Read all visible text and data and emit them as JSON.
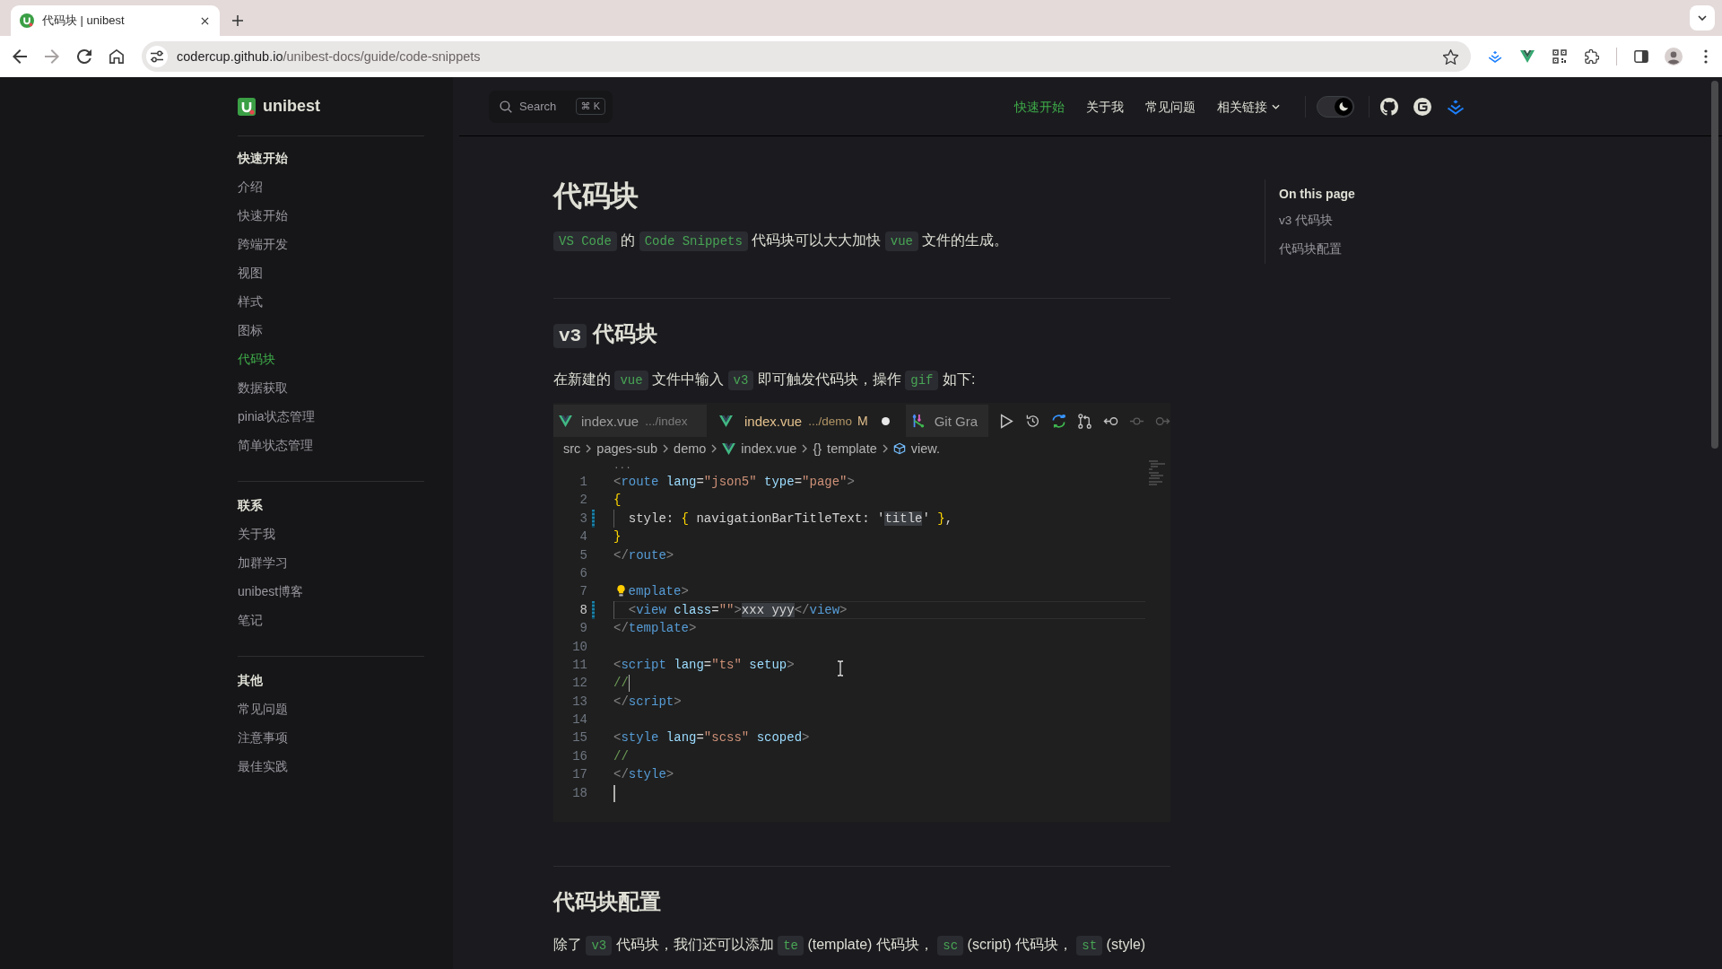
{
  "browser": {
    "tab": {
      "title": "代码块 | unibest",
      "selected": true
    },
    "url": {
      "host": "codercup.github.io",
      "path": "/unibest-docs/guide/code-snippets"
    }
  },
  "header": {
    "site_name": "unibest",
    "search": {
      "label": "Search",
      "shortcut": "⌘ K"
    },
    "nav": [
      {
        "label": "快速开始",
        "kind": "link",
        "selected": true
      },
      {
        "label": "关于我",
        "kind": "link",
        "selected": false
      },
      {
        "label": "常见问题",
        "kind": "link",
        "selected": false
      },
      {
        "label": "相关链接",
        "kind": "dropdown",
        "selected": false
      }
    ],
    "dark_mode": true
  },
  "sidebar": {
    "groups": [
      {
        "title": "快速开始",
        "items": [
          {
            "label": "介绍",
            "selected": false
          },
          {
            "label": "快速开始",
            "selected": false
          },
          {
            "label": "跨端开发",
            "selected": false
          },
          {
            "label": "视图",
            "selected": false
          },
          {
            "label": "样式",
            "selected": false
          },
          {
            "label": "图标",
            "selected": false
          },
          {
            "label": "代码块",
            "selected": true
          },
          {
            "label": "数据获取",
            "selected": false
          },
          {
            "label": "pinia状态管理",
            "selected": false
          },
          {
            "label": "简单状态管理",
            "selected": false
          }
        ]
      },
      {
        "title": "联系",
        "items": [
          {
            "label": "关于我",
            "selected": false
          },
          {
            "label": "加群学习",
            "selected": false
          },
          {
            "label": "unibest博客",
            "selected": false
          },
          {
            "label": "笔记",
            "selected": false
          }
        ]
      },
      {
        "title": "其他",
        "items": [
          {
            "label": "常见问题",
            "selected": false
          },
          {
            "label": "注意事项",
            "selected": false
          },
          {
            "label": "最佳实践",
            "selected": false
          }
        ]
      }
    ]
  },
  "article": {
    "title": "代码块",
    "intro": [
      {
        "kind": "code",
        "text": "VS Code"
      },
      {
        "kind": "text",
        "text": " 的 "
      },
      {
        "kind": "code",
        "text": "Code Snippets"
      },
      {
        "kind": "text",
        "text": " 代码块可以大大加快 "
      },
      {
        "kind": "code",
        "text": "vue"
      },
      {
        "kind": "text",
        "text": " 文件的生成。"
      }
    ],
    "sections": [
      {
        "heading": [
          {
            "kind": "code",
            "text": "v3"
          },
          {
            "kind": "text",
            "text": " 代码块"
          }
        ],
        "paragraph": [
          {
            "kind": "text",
            "text": "在新建的 "
          },
          {
            "kind": "code",
            "text": "vue"
          },
          {
            "kind": "text",
            "text": " 文件中输入 "
          },
          {
            "kind": "code",
            "text": "v3"
          },
          {
            "kind": "text",
            "text": " 即可触发代码块，操作 "
          },
          {
            "kind": "code",
            "text": "gif"
          },
          {
            "kind": "text",
            "text": " 如下:"
          }
        ],
        "editor": {
          "tabs": [
            {
              "kind": "file",
              "name": "index.vue",
              "path": ".../index",
              "modified": false,
              "selected": false
            },
            {
              "kind": "file",
              "name": "index.vue",
              "path": ".../demo",
              "badge": "M",
              "modified": true,
              "selected": true
            },
            {
              "kind": "git-graph",
              "name": "Git Gra",
              "selected": false
            }
          ],
          "breadcrumbs": [
            {
              "kind": "folder",
              "label": "src"
            },
            {
              "kind": "folder",
              "label": "pages-sub"
            },
            {
              "kind": "folder",
              "label": "demo"
            },
            {
              "kind": "vue-file",
              "label": "index.vue"
            },
            {
              "kind": "braces",
              "glyph": "{}",
              "label": "template"
            },
            {
              "kind": "element",
              "label": "view."
            }
          ],
          "fold_marker": "...",
          "lines": [
            {
              "number": "1",
              "current": false,
              "changed": false,
              "tokens": [
                {
                  "kind": "punct",
                  "text": "<"
                },
                {
                  "kind": "tag",
                  "text": "route"
                },
                {
                  "kind": "attr",
                  "text": " lang"
                },
                {
                  "kind": "text",
                  "text": "="
                },
                {
                  "kind": "string",
                  "text": "\"json5\""
                },
                {
                  "kind": "attr",
                  "text": " type"
                },
                {
                  "kind": "text",
                  "text": "="
                },
                {
                  "kind": "string",
                  "text": "\"page\""
                },
                {
                  "kind": "punct",
                  "text": ">"
                }
              ]
            },
            {
              "number": "2",
              "current": false,
              "changed": false,
              "tokens": [
                {
                  "kind": "bracket",
                  "text": "{"
                }
              ]
            },
            {
              "number": "3",
              "current": false,
              "changed": true,
              "tokens": [
                {
                  "kind": "indent"
                },
                {
                  "kind": "text",
                  "text": "style: "
                },
                {
                  "kind": "bracket",
                  "text": "{"
                },
                {
                  "kind": "text",
                  "text": " navigationBarTitleText: '"
                },
                {
                  "kind": "match",
                  "text": "title"
                },
                {
                  "kind": "text",
                  "text": "' "
                },
                {
                  "kind": "bracket",
                  "text": "}"
                },
                {
                  "kind": "text",
                  "text": ","
                }
              ]
            },
            {
              "number": "4",
              "current": false,
              "changed": false,
              "tokens": [
                {
                  "kind": "bracket",
                  "text": "}"
                }
              ]
            },
            {
              "number": "5",
              "current": false,
              "changed": false,
              "tokens": [
                {
                  "kind": "punct",
                  "text": "</"
                },
                {
                  "kind": "tag",
                  "text": "route"
                },
                {
                  "kind": "punct",
                  "text": ">"
                }
              ]
            },
            {
              "number": "6",
              "current": false,
              "changed": false
            },
            {
              "number": "7",
              "current": false,
              "changed": false,
              "tokens": [
                {
                  "kind": "lightbulb"
                },
                {
                  "kind": "tag",
                  "text": "emplate"
                },
                {
                  "kind": "punct",
                  "text": ">"
                }
              ]
            },
            {
              "number": "8",
              "current": true,
              "changed": true,
              "tokens": [
                {
                  "kind": "indent"
                },
                {
                  "kind": "punct",
                  "text": "<"
                },
                {
                  "kind": "tag",
                  "text": "view"
                },
                {
                  "kind": "attr",
                  "text": " class"
                },
                {
                  "kind": "text",
                  "text": "="
                },
                {
                  "kind": "string",
                  "text": "\"\""
                },
                {
                  "kind": "punct",
                  "text": ">"
                },
                {
                  "kind": "match",
                  "text": "xxx yyy"
                },
                {
                  "kind": "punct",
                  "text": "</"
                },
                {
                  "kind": "tag",
                  "text": "view"
                },
                {
                  "kind": "punct",
                  "text": ">"
                }
              ]
            },
            {
              "number": "9",
              "current": false,
              "changed": false,
              "tokens": [
                {
                  "kind": "punct",
                  "text": "</"
                },
                {
                  "kind": "tag",
                  "text": "template"
                },
                {
                  "kind": "punct",
                  "text": ">"
                }
              ]
            },
            {
              "number": "10",
              "current": false,
              "changed": false
            },
            {
              "number": "11",
              "current": false,
              "changed": false,
              "tokens": [
                {
                  "kind": "punct",
                  "text": "<"
                },
                {
                  "kind": "tag",
                  "text": "script"
                },
                {
                  "kind": "attr",
                  "text": " lang"
                },
                {
                  "kind": "text",
                  "text": "="
                },
                {
                  "kind": "string",
                  "text": "\"ts\""
                },
                {
                  "kind": "attr",
                  "text": " setup"
                },
                {
                  "kind": "punct",
                  "text": ">"
                }
              ]
            },
            {
              "number": "12",
              "current": false,
              "changed": false,
              "tokens": [
                {
                  "kind": "comment",
                  "text": "//"
                },
                {
                  "kind": "cursor"
                }
              ]
            },
            {
              "number": "13",
              "current": false,
              "changed": false,
              "tokens": [
                {
                  "kind": "punct",
                  "text": "</"
                },
                {
                  "kind": "tag",
                  "text": "script"
                },
                {
                  "kind": "punct",
                  "text": ">"
                }
              ]
            },
            {
              "number": "14",
              "current": false,
              "changed": false
            },
            {
              "number": "15",
              "current": false,
              "changed": false,
              "tokens": [
                {
                  "kind": "punct",
                  "text": "<"
                },
                {
                  "kind": "tag",
                  "text": "style"
                },
                {
                  "kind": "attr",
                  "text": " lang"
                },
                {
                  "kind": "text",
                  "text": "="
                },
                {
                  "kind": "string",
                  "text": "\"scss\""
                },
                {
                  "kind": "attr",
                  "text": " scoped"
                },
                {
                  "kind": "punct",
                  "text": ">"
                }
              ]
            },
            {
              "number": "16",
              "current": false,
              "changed": false,
              "tokens": [
                {
                  "kind": "comment",
                  "text": "//"
                }
              ]
            },
            {
              "number": "17",
              "current": false,
              "changed": false,
              "tokens": [
                {
                  "kind": "punct",
                  "text": "</"
                },
                {
                  "kind": "tag",
                  "text": "style"
                },
                {
                  "kind": "punct",
                  "text": ">"
                }
              ]
            },
            {
              "number": "18",
              "current": false,
              "changed": false,
              "tokens": [
                {
                  "kind": "cursor"
                }
              ]
            }
          ]
        }
      },
      {
        "heading": [
          {
            "kind": "text",
            "text": "代码块配置"
          }
        ],
        "paragraph": [
          {
            "kind": "text",
            "text": "除了 "
          },
          {
            "kind": "code",
            "text": "v3"
          },
          {
            "kind": "text",
            "text": " 代码块，我们还可以添加 "
          },
          {
            "kind": "code",
            "text": "te"
          },
          {
            "kind": "text",
            "text": " (template) 代码块， "
          },
          {
            "kind": "code",
            "text": "sc"
          },
          {
            "kind": "text",
            "text": " (script) 代码块， "
          },
          {
            "kind": "code",
            "text": "st"
          },
          {
            "kind": "text",
            "text": " (style)"
          }
        ]
      }
    ]
  },
  "outline": {
    "title": "On this page",
    "items": [
      {
        "label": "v3 代码块",
        "selected": false
      },
      {
        "label": "代码块配置",
        "selected": false
      }
    ]
  }
}
